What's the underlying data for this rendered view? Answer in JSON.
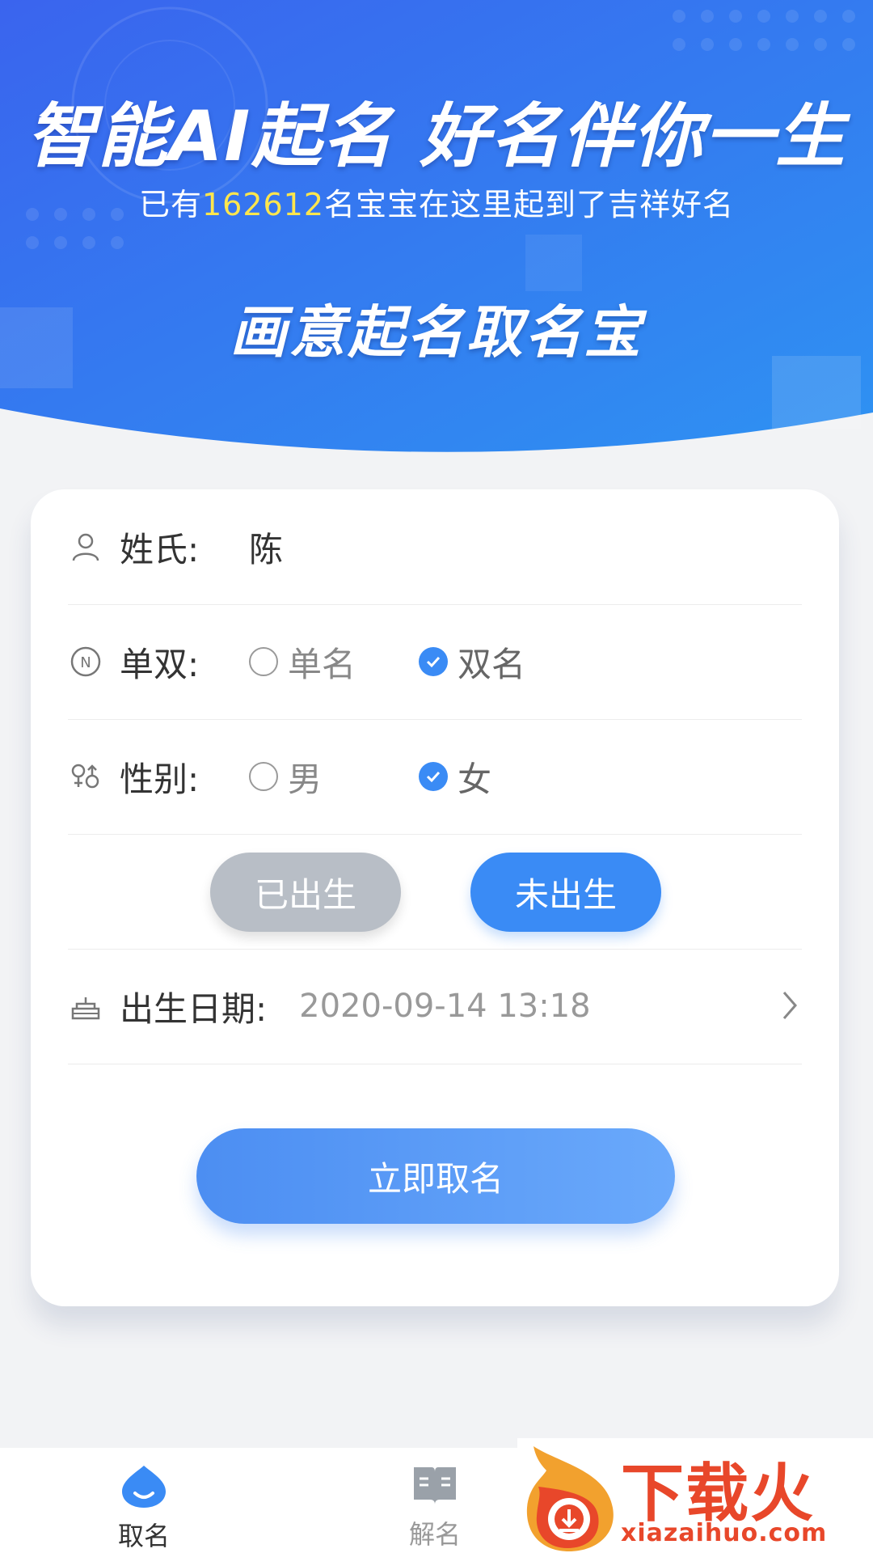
{
  "hero": {
    "title": "智能AI起名 好名伴你一生",
    "subtitle_prefix": "已有",
    "subtitle_count": "162612",
    "subtitle_suffix": "名宝宝在这里起到了吉祥好名",
    "app_name": "画意起名取名宝"
  },
  "form": {
    "surname": {
      "label": "姓氏:",
      "value": "陈",
      "icon": "person-icon"
    },
    "name_length": {
      "label": "单双:",
      "icon": "n-circle-icon",
      "options": [
        "单名",
        "双名"
      ],
      "selected": "双名"
    },
    "gender": {
      "label": "性别:",
      "icon": "gender-icon",
      "options": [
        "男",
        "女"
      ],
      "selected": "女"
    },
    "birth_status": {
      "born_label": "已出生",
      "unborn_label": "未出生",
      "selected": "未出生"
    },
    "birth_date": {
      "label": "出生日期:",
      "value": "2020-09-14 13:18",
      "icon": "cake-icon"
    },
    "submit_label": "立即取名"
  },
  "tabs": [
    {
      "label": "取名",
      "icon": "mascot-icon",
      "active": true
    },
    {
      "label": "解名",
      "icon": "book-icon",
      "active": false
    }
  ],
  "watermark": {
    "text": "下载火",
    "url": "xiazaihuo.com"
  },
  "colors": {
    "accent": "#3a8bf5",
    "hero_top": "#3a6ff0",
    "hero_bottom": "#2f8cf2",
    "count_highlight": "#ffe64d",
    "watermark": "#e8472a"
  }
}
